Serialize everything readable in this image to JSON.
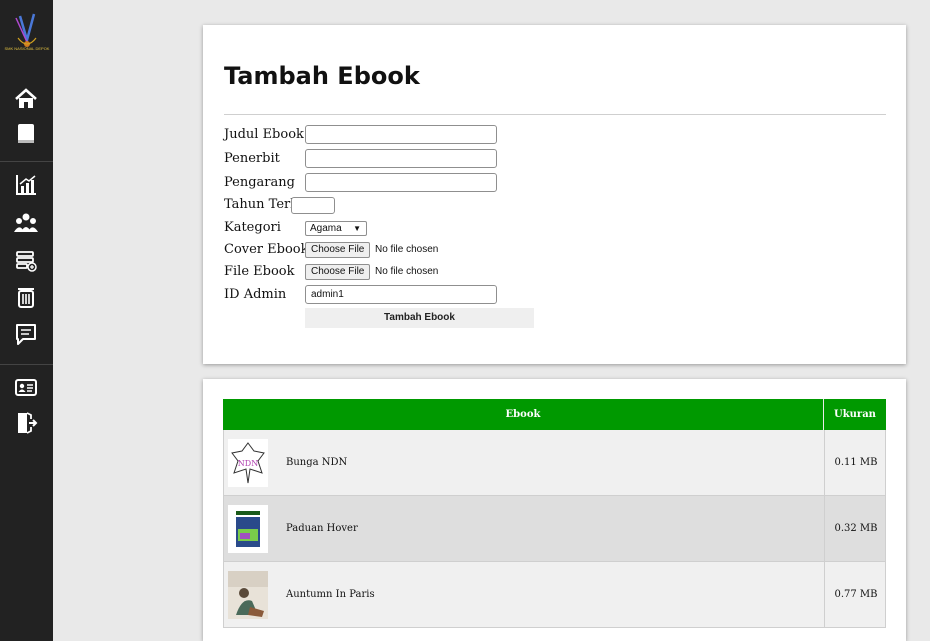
{
  "sidebar": {
    "logo_text": "SMK NASIONAL DEPOK",
    "icons": [
      "home-icon",
      "book-icon",
      "chart-icon",
      "users-icon",
      "storage-add-icon",
      "trash-icon",
      "chat-icon",
      "id-card-icon",
      "logout-icon"
    ]
  },
  "form": {
    "title": "Tambah Ebook",
    "judul_label": "Judul Ebook",
    "judul_value": "",
    "penerbit_label": "Penerbit",
    "penerbit_value": "",
    "pengarang_label": "Pengarang",
    "pengarang_value": "",
    "tahun_label": "Tahun Terbit",
    "tahun_value": "",
    "kategori_label": "Kategori",
    "kategori_selected": "Agama",
    "cover_label": "Cover Ebook",
    "cover_button": "Choose File",
    "cover_status": "No file chosen",
    "file_label": "File Ebook",
    "file_button": "Choose File",
    "file_status": "No file chosen",
    "admin_label": "ID Admin",
    "admin_value": "admin1",
    "submit_label": "Tambah Ebook"
  },
  "table": {
    "header_color": "#009900",
    "columns": [
      "Ebook",
      "Ukuran"
    ],
    "rows": [
      {
        "title": "Bunga NDN",
        "size": "0.11 MB",
        "cover": "ndn-cover"
      },
      {
        "title": "Paduan Hover",
        "size": "0.32 MB",
        "cover": "book-cover"
      },
      {
        "title": "Auntumn In Paris",
        "size": "0.77 MB",
        "cover": "photo-cover"
      }
    ]
  }
}
